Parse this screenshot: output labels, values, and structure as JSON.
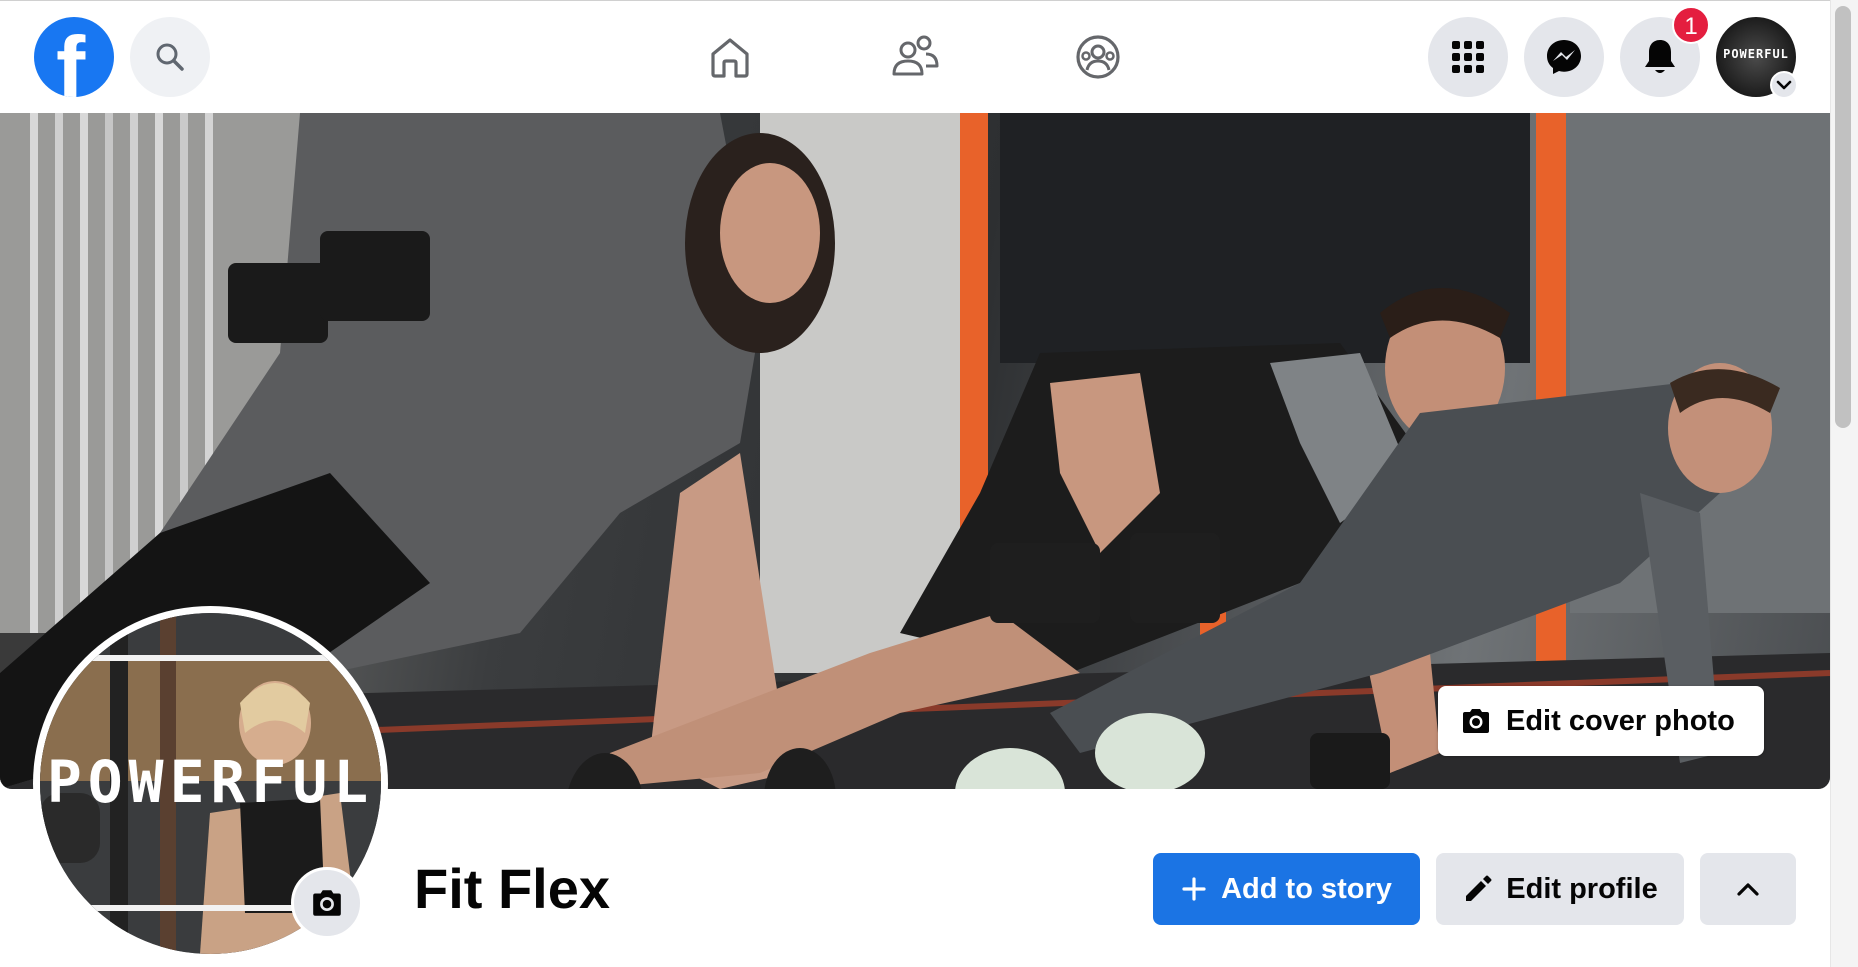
{
  "nav": {
    "logo_letter": "f",
    "notifications_count": "1",
    "account_avatar_text": "POWERFUL",
    "icons": {
      "search": "search-icon",
      "home": "home-icon",
      "friends": "friends-icon",
      "groups": "groups-icon",
      "menu": "grid-menu-icon",
      "messenger": "messenger-icon",
      "notifications": "bell-icon",
      "account": "chevron-down-icon"
    }
  },
  "cover": {
    "edit_cover_label": "Edit cover photo"
  },
  "profile": {
    "name": "Fit Flex",
    "avatar_text": "POWERFUL",
    "add_story_label": "Add to story",
    "edit_profile_label": "Edit profile"
  },
  "colors": {
    "brand": "#1877f2",
    "primary_button": "#1b74e4",
    "badge": "#e41e3f",
    "secondary_button": "#e4e6eb"
  }
}
